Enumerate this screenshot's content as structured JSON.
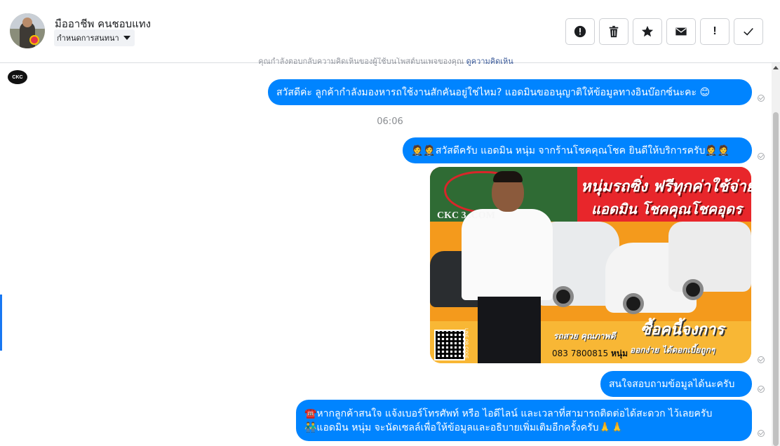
{
  "header": {
    "contact_name": "มืออาชีพ คนชอบแทง",
    "tag_label": "กำหนดการสนทนา",
    "actions": [
      {
        "name": "spam-icon"
      },
      {
        "name": "trash-icon"
      },
      {
        "name": "star-icon"
      },
      {
        "name": "mail-icon"
      },
      {
        "name": "exclamation-icon",
        "label": "!"
      },
      {
        "name": "checkmark-icon"
      }
    ]
  },
  "notice": {
    "text": "คุณกำลังตอบกลับความคิดเห็นของผู้ใช้บนโพสต์บนเพจของคุณ",
    "link": "ดูความคิดเห็น"
  },
  "page_badge": "CKC",
  "conversation": {
    "timestamp": "06:06",
    "messages": [
      {
        "text": "สวัสดีค่ะ ลูกค้ากำลังมองหารถใช้งานสักคันอยู่ใช่ไหม? แอดมินขออนุญาติให้ข้อมูลทางอินบ๊อกซ์นะคะ 😊"
      },
      {
        "text": "🤵🤵สวัสดีครับ แอดมิน หนุ่ม จากร้านโชคคุณโชค ยินดีให้บริการครับ🤵🤵"
      },
      {
        "text": "สนใจสอบถามข้อมูลได้นะครับ"
      },
      {
        "line1": "☎️หากลูกค้าสนใจ แจ้งเบอร์โทรศัพท์ หรือ ไอดีไลน์ และเวลาที่สามารถติดต่อได้สะดวก ไว้เลยครับ",
        "line2": "👬แอดมิน หนุ่ม จะนัดเซลล์เพื่อให้ข้อมูลและอธิบายเพิ่มเติมอีกครั้งครับ🙏🙏"
      }
    ]
  },
  "attachment": {
    "headline1": "หนุ่มรถซิ่ง ฟรีทุกค่าใช้จ่าย",
    "headline2": "แอดมิน โชคคุณโชคอุดร",
    "brand": "CKC 3   .COM",
    "headline3": "ซื้อคนี้จงการ",
    "sub1": "รถสวย คุณภาพดี",
    "phone_number": "083 7800815",
    "phone_name": "หนุ่ม",
    "sub2": "ออกง่าย ได้ดอกเบี้ยถูกๆ",
    "qr_label": "LINE QR CODE"
  },
  "colors": {
    "bubble": "#0084ff",
    "accent": "#1877f2"
  }
}
